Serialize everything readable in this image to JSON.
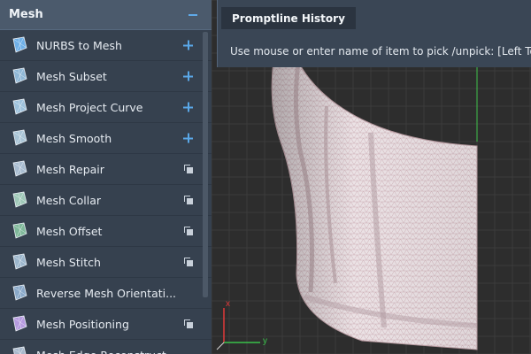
{
  "panel": {
    "title": "Mesh",
    "items": [
      {
        "label": "NURBS to Mesh",
        "icon": "nurbs-to-mesh-icon",
        "action": "plus"
      },
      {
        "label": "Mesh Subset",
        "icon": "mesh-subset-icon",
        "action": "plus"
      },
      {
        "label": "Mesh Project Curve",
        "icon": "mesh-project-curve-icon",
        "action": "plus"
      },
      {
        "label": "Mesh Smooth",
        "icon": "mesh-smooth-icon",
        "action": "plus"
      },
      {
        "label": "Mesh Repair",
        "icon": "mesh-repair-icon",
        "action": "copy"
      },
      {
        "label": "Mesh Collar",
        "icon": "mesh-collar-icon",
        "action": "copy"
      },
      {
        "label": "Mesh Offset",
        "icon": "mesh-offset-icon",
        "action": "copy"
      },
      {
        "label": "Mesh Stitch",
        "icon": "mesh-stitch-icon",
        "action": "copy"
      },
      {
        "label": "Reverse Mesh Orientati...",
        "icon": "reverse-mesh-orientation-icon",
        "action": "none"
      },
      {
        "label": "Mesh Positioning",
        "icon": "mesh-positioning-icon",
        "action": "copy"
      },
      {
        "label": "Mesh Edge Reconstruct",
        "icon": "mesh-edge-reconstruct-icon",
        "action": "none"
      }
    ]
  },
  "history": {
    "title": "Promptline History",
    "message": "Use mouse or enter name of item to pick /unpick: [Left Tog"
  },
  "axes": {
    "x_label": "x",
    "y_label": "y"
  },
  "colors": {
    "accent": "#5aa8e8",
    "panel_bg": "#36414f",
    "mesh": "#e8dde0",
    "x_axis": "#e03a3a",
    "y_axis": "#3ac24a"
  }
}
